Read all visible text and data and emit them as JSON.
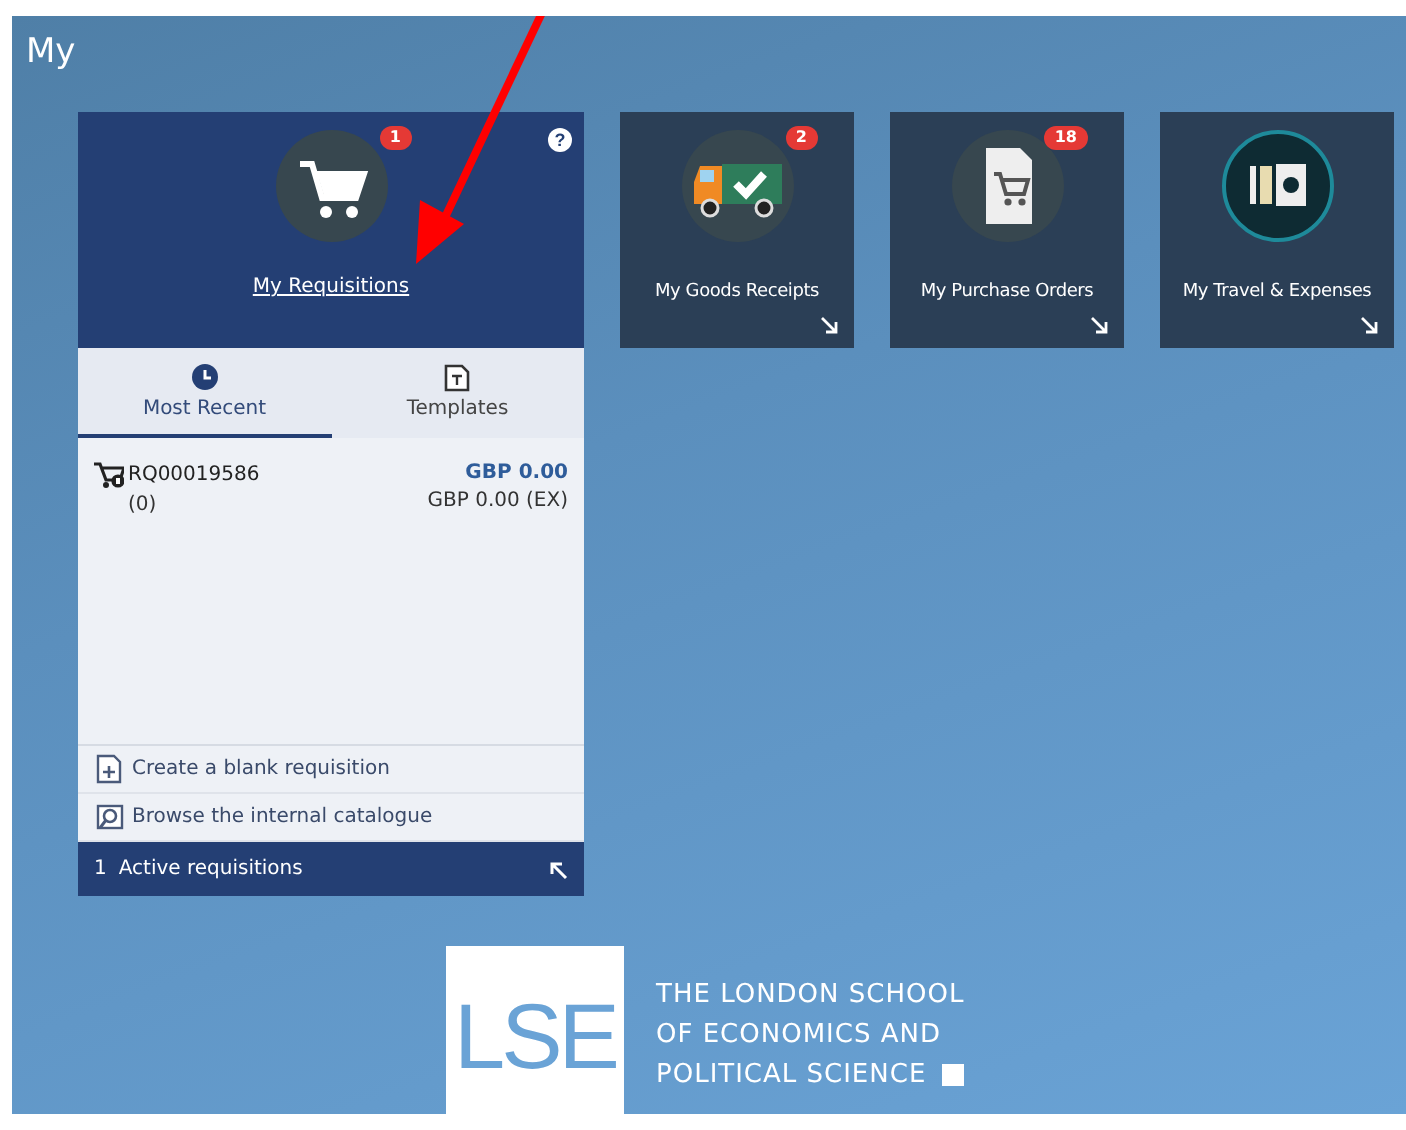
{
  "page": {
    "title": "My"
  },
  "requisitions": {
    "title": "My Requisitions",
    "badge": "1",
    "help": "?",
    "tabs": [
      {
        "label": "Most Recent",
        "kind": "clock",
        "selected": true
      },
      {
        "label": "Templates",
        "kind": "template",
        "selected": false
      }
    ],
    "items": [
      {
        "number": "RQ00019586",
        "count": "(0)",
        "total": "GBP 0.00",
        "total_ex": "GBP 0.00 (EX)"
      }
    ],
    "actions": [
      {
        "label": "Create a blank requisition",
        "kind": "add"
      },
      {
        "label": "Browse the internal catalogue",
        "kind": "browse"
      }
    ],
    "footer": {
      "count": "1",
      "label": "Active requisitions"
    }
  },
  "tiles": [
    {
      "title": "My Goods Receipts",
      "kind": "truck",
      "badge": "2"
    },
    {
      "title": "My Purchase Orders",
      "kind": "order",
      "badge": "18"
    },
    {
      "title": "My Travel & Expenses",
      "kind": "money"
    }
  ],
  "logo": {
    "mark": "LSE",
    "lines": [
      "THE LONDON SCHOOL",
      "OF ECONOMICS AND",
      "POLITICAL SCIENCE"
    ]
  }
}
